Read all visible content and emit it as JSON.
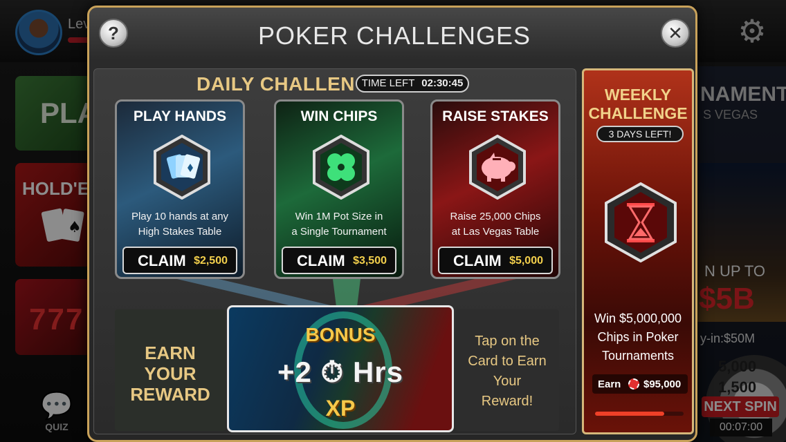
{
  "lobby": {
    "username": "Lev",
    "tiles": {
      "play": "PLA",
      "holdem": "HOLD'EM",
      "slots": "777"
    },
    "quiz_label": "QUIZ",
    "right_panel": {
      "tournament_partial": "NAMENT",
      "vegas_partial": "S VEGAS",
      "win_partial": "N UP TO",
      "amount_partial": "$5B",
      "buyin_partial": "y-in:$50M",
      "wheel_values": [
        "5,000",
        "1,500"
      ],
      "next_spin_label": "NEXT SPIN",
      "next_spin_timer": "00:07:00"
    }
  },
  "modal": {
    "title": "POKER CHALLENGES",
    "help_symbol": "?",
    "close_symbol": "✕",
    "daily": {
      "label": "DAILY CHALLENGE",
      "time_left_label": "TIME LEFT",
      "time_left_value": "02:30:45",
      "cards": [
        {
          "title": "PLAY HANDS",
          "icon": "cards-icon",
          "desc_line1": "Play 10 hands at any",
          "desc_line2": "High Stakes Table",
          "claim_label": "CLAIM",
          "reward": "$2,500",
          "color": "#2c5a7c"
        },
        {
          "title": "WIN CHIPS",
          "icon": "clover-icon",
          "desc_line1": "Win 1M Pot Size in",
          "desc_line2": "a Single Tournament",
          "claim_label": "CLAIM",
          "reward": "$3,500",
          "color": "#1d6a3a"
        },
        {
          "title": "RAISE STAKES",
          "icon": "piggy-bank-icon",
          "desc_line1": "Raise 25,000 Chips",
          "desc_line2": "at Las Vegas Table",
          "claim_label": "CLAIM",
          "reward": "$5,000",
          "color": "#8a1616"
        }
      ],
      "earn_reward": [
        "EARN",
        "YOUR",
        "REWARD"
      ],
      "bonus": {
        "top": "BONUS",
        "middle": "+2 ⏱ Hrs",
        "bottom": "XP"
      },
      "tap_text": [
        "Tap on the",
        "Card to Earn",
        "Your",
        "Reward!"
      ]
    },
    "weekly": {
      "title_line1": "WEEKLY",
      "title_line2": "CHALLENGE",
      "days_left": "3 DAYS LEFT!",
      "icon": "hourglass-icon",
      "desc_line1": "Win $5,000,000",
      "desc_line2": "Chips in Poker",
      "desc_line3": "Tournaments",
      "earn_label": "Earn",
      "earn_amount": "$95,000",
      "progress": 0.78
    }
  },
  "colors": {
    "gold_text": "#e7c883",
    "modal_border": "#c9a25a",
    "reward_yellow": "#f4d04c",
    "accent_red": "#c91d22"
  }
}
